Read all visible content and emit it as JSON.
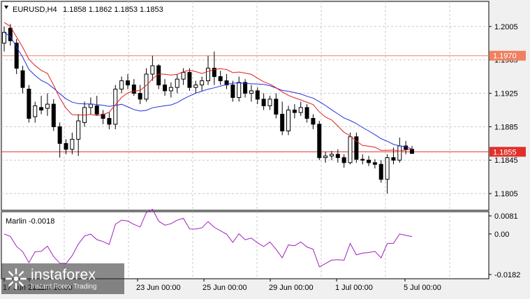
{
  "header": {
    "symbol": "EURUSD,H4",
    "ohlc": "1.1858 1.1862 1.1853 1.1853"
  },
  "price_axis": {
    "ticks": [
      "1.2005",
      "1.1965",
      "1.1925",
      "1.1885",
      "1.1845",
      "1.1805"
    ]
  },
  "hlines": [
    {
      "label": "1.1970",
      "value": 1.197,
      "color": "#f08060"
    },
    {
      "label": "1.1855",
      "value": 1.1855,
      "color": "#e0302a"
    }
  ],
  "indicator": {
    "title": "Marlin -0.0018",
    "ticks": [
      "0.0081",
      "0.00",
      "-0.0182"
    ],
    "color": "#a020c0"
  },
  "time_axis": {
    "labels": [
      "17 Jun 2021",
      "21 Jun 16:00",
      "23 Jun 00:00",
      "25 Jun 00:00",
      "29 Jun 00:00",
      "1 Jul 00:00",
      "5 Jul 00:00"
    ]
  },
  "logo": {
    "name": "instaforex",
    "tagline": "Instant Forex Trading"
  },
  "colors": {
    "background": "#ffffff",
    "candle": "#000000",
    "ma_blue": "#2030e0",
    "envelope_red": "#e02020"
  },
  "chart_data": {
    "type": "candlestick",
    "ylim": [
      1.1785,
      1.2035
    ],
    "candles": [
      [
        1.1985,
        1.2005,
        1.1975,
        1.1998
      ],
      [
        1.2003,
        1.2008,
        1.1982,
        1.1988
      ],
      [
        1.1985,
        1.199,
        1.1948,
        1.1955
      ],
      [
        1.1952,
        1.1958,
        1.1925,
        1.1932
      ],
      [
        1.193,
        1.1935,
        1.189,
        1.1895
      ],
      [
        1.1897,
        1.1915,
        1.189,
        1.191
      ],
      [
        1.1908,
        1.1922,
        1.19,
        1.1905
      ],
      [
        1.1907,
        1.1925,
        1.1898,
        1.1912
      ],
      [
        1.1912,
        1.1918,
        1.188,
        1.1885
      ],
      [
        1.1885,
        1.189,
        1.1848,
        1.1865
      ],
      [
        1.1865,
        1.187,
        1.1852,
        1.1858
      ],
      [
        1.1858,
        1.1878,
        1.1852,
        1.187
      ],
      [
        1.187,
        1.19,
        1.185,
        1.1892
      ],
      [
        1.189,
        1.1915,
        1.1885,
        1.1908
      ],
      [
        1.1908,
        1.192,
        1.19,
        1.1912
      ],
      [
        1.191,
        1.1922,
        1.1898,
        1.19
      ],
      [
        1.19,
        1.1905,
        1.1888,
        1.1895
      ],
      [
        1.1895,
        1.1902,
        1.1882,
        1.1888
      ],
      [
        1.1888,
        1.1935,
        1.1882,
        1.193
      ],
      [
        1.193,
        1.1945,
        1.1925,
        1.194
      ],
      [
        1.194,
        1.1948,
        1.193,
        1.1935
      ],
      [
        1.1935,
        1.1942,
        1.1922,
        1.1925
      ],
      [
        1.1925,
        1.1935,
        1.1912,
        1.1918
      ],
      [
        1.1918,
        1.1955,
        1.1915,
        1.1948
      ],
      [
        1.1948,
        1.197,
        1.194,
        1.1958
      ],
      [
        1.1958,
        1.196,
        1.193,
        1.1935
      ],
      [
        1.1935,
        1.1942,
        1.1922,
        1.1928
      ],
      [
        1.1928,
        1.1938,
        1.192,
        1.1932
      ],
      [
        1.1932,
        1.1948,
        1.1925,
        1.1942
      ],
      [
        1.1942,
        1.1955,
        1.1935,
        1.195
      ],
      [
        1.195,
        1.1955,
        1.1928,
        1.1932
      ],
      [
        1.1932,
        1.194,
        1.1925,
        1.1935
      ],
      [
        1.1935,
        1.1945,
        1.1928,
        1.194
      ],
      [
        1.194,
        1.197,
        1.1935,
        1.1955
      ],
      [
        1.1955,
        1.1975,
        1.1935,
        1.1945
      ],
      [
        1.1945,
        1.1952,
        1.1935,
        1.194
      ],
      [
        1.194,
        1.1948,
        1.193,
        1.1935
      ],
      [
        1.1935,
        1.194,
        1.1915,
        1.192
      ],
      [
        1.192,
        1.1945,
        1.1915,
        1.1938
      ],
      [
        1.1938,
        1.1942,
        1.192,
        1.1925
      ],
      [
        1.1925,
        1.1935,
        1.1915,
        1.1928
      ],
      [
        1.1928,
        1.1932,
        1.1912,
        1.1918
      ],
      [
        1.1918,
        1.1925,
        1.1905,
        1.191
      ],
      [
        1.191,
        1.1922,
        1.1905,
        1.1918
      ],
      [
        1.1918,
        1.1925,
        1.1895,
        1.19
      ],
      [
        1.19,
        1.1915,
        1.1875,
        1.188
      ],
      [
        1.188,
        1.191,
        1.1875,
        1.1905
      ],
      [
        1.1905,
        1.1912,
        1.1895,
        1.1902
      ],
      [
        1.1902,
        1.1915,
        1.1898,
        1.1908
      ],
      [
        1.1908,
        1.1912,
        1.189,
        1.1895
      ],
      [
        1.1895,
        1.19,
        1.1882,
        1.1888
      ],
      [
        1.1888,
        1.1892,
        1.1845,
        1.1848
      ],
      [
        1.1848,
        1.1855,
        1.1842,
        1.185
      ],
      [
        1.185,
        1.1856,
        1.1845,
        1.1852
      ],
      [
        1.1852,
        1.1858,
        1.1842,
        1.1848
      ],
      [
        1.1848,
        1.1852,
        1.1836,
        1.1842
      ],
      [
        1.1842,
        1.1878,
        1.184,
        1.1873
      ],
      [
        1.1873,
        1.1878,
        1.1842,
        1.1846
      ],
      [
        1.1846,
        1.1852,
        1.184,
        1.1845
      ],
      [
        1.1845,
        1.185,
        1.1838,
        1.1842
      ],
      [
        1.1842,
        1.1846,
        1.1835,
        1.184
      ],
      [
        1.184,
        1.1845,
        1.1818,
        1.1822
      ],
      [
        1.1822,
        1.1852,
        1.1805,
        1.1848
      ],
      [
        1.1848,
        1.186,
        1.184,
        1.1845
      ],
      [
        1.1845,
        1.1872,
        1.1842,
        1.1862
      ],
      [
        1.1862,
        1.1868,
        1.1852,
        1.1858
      ],
      [
        1.1858,
        1.1862,
        1.1853,
        1.1853
      ]
    ]
  }
}
